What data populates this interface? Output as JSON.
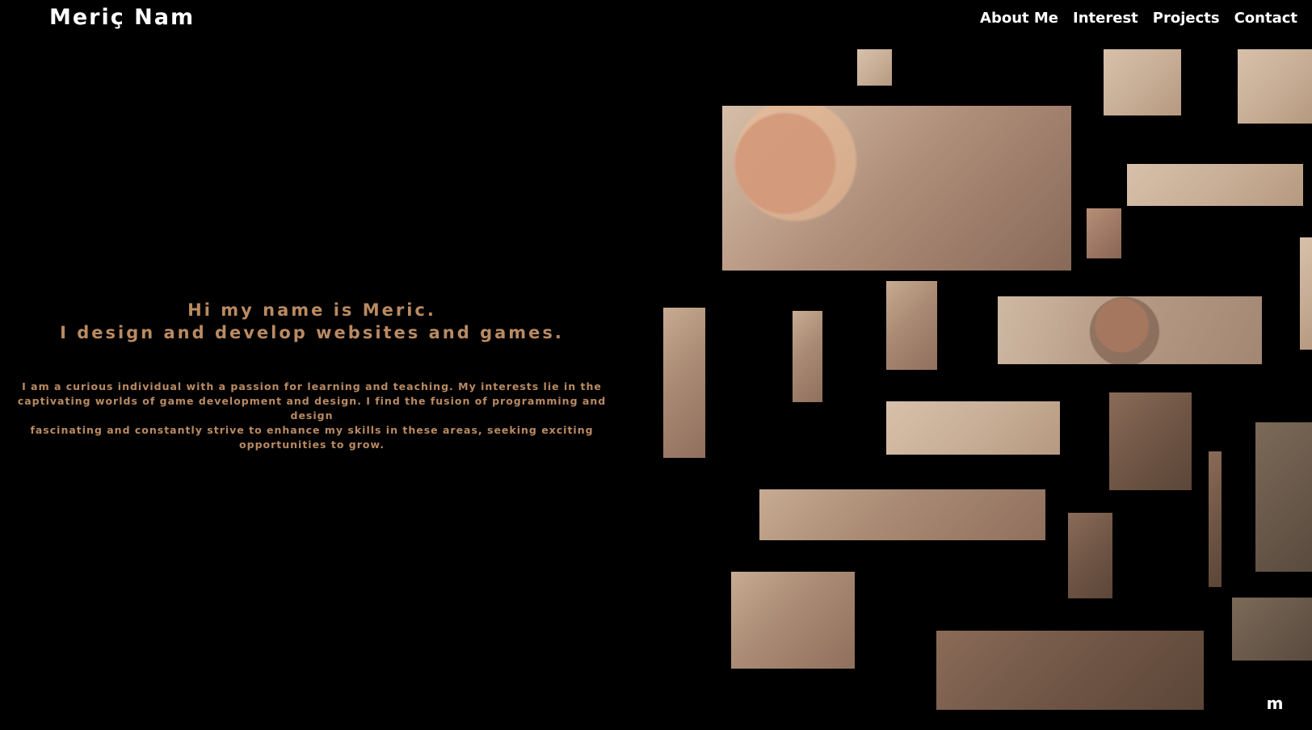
{
  "header": {
    "brand": "Meriç Nam",
    "nav": [
      {
        "label": "About Me"
      },
      {
        "label": "Interest"
      },
      {
        "label": "Projects"
      },
      {
        "label": "Contact"
      }
    ]
  },
  "hero": {
    "line1": "Hi my name is Meric.",
    "line2": "I design and develop websites and games."
  },
  "bio": {
    "lines": [
      "I am a curious individual with a passion for learning and teaching. My interests lie in the",
      "captivating worlds of game development and design. I find the fusion of programming and design",
      "fascinating and constantly strive to enhance my skills in these areas, seeking exciting",
      "opportunities to grow."
    ]
  },
  "corner_logo": "m",
  "colors": {
    "background": "#000000",
    "nav_text": "#ffffff",
    "accent": "#b98a62"
  },
  "icons": {
    "corner_logo_icon": "m-logo-icon"
  }
}
